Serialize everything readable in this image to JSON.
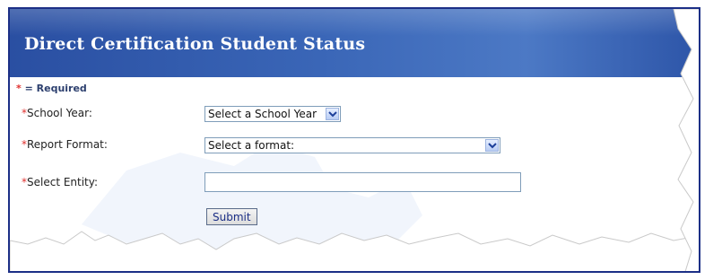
{
  "header": {
    "title": "Direct Certification Student Status"
  },
  "required_note": {
    "star": "*",
    "text": " = Required"
  },
  "form": {
    "school_year": {
      "star": "*",
      "label": "School Year:",
      "value": "Select a School Year"
    },
    "report_format": {
      "star": "*",
      "label": "Report Format:",
      "value": "Select a format:"
    },
    "select_entity": {
      "star": "*",
      "label": "Select Entity:",
      "value": ""
    },
    "submit_label": "Submit"
  },
  "colors": {
    "header_blue": "#3a66b7",
    "frame_border": "#1c2f86",
    "required_star": "#e0302e"
  },
  "icons": {
    "dropdown": "chevron-down-icon"
  }
}
